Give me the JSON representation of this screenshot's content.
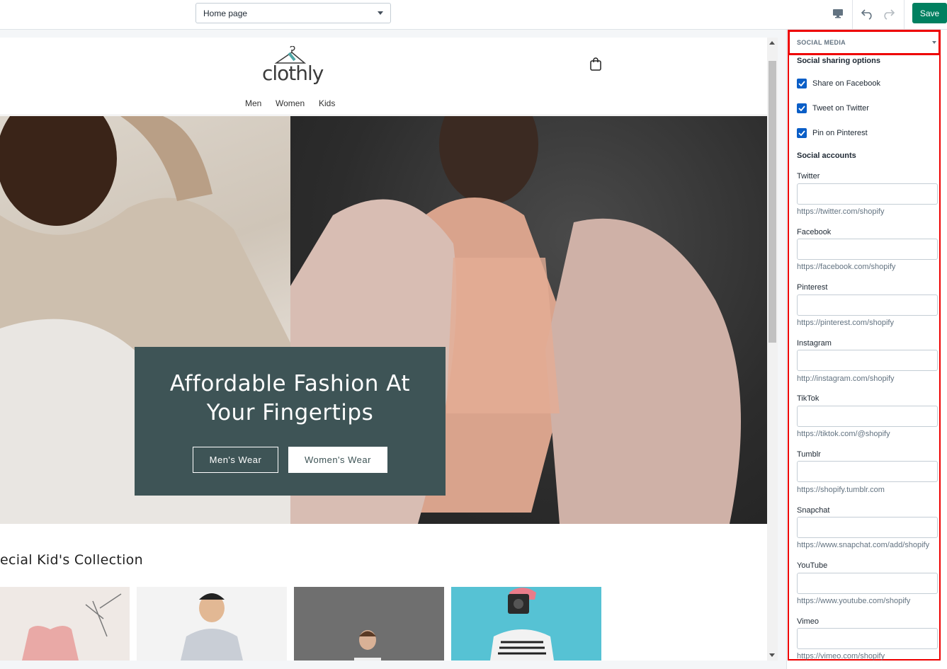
{
  "toolbar": {
    "page_select_value": "Home page",
    "desktop_icon": "desktop-icon",
    "undo_icon": "undo-icon",
    "redo_icon": "redo-icon",
    "save_label": "Save",
    "save_color": "#008060"
  },
  "store": {
    "logo_text": "clothly",
    "nav": [
      "Men",
      "Women",
      "Kids"
    ],
    "hero": {
      "title_line1": "Affordable Fashion At",
      "title_line2": "Your Fingertips",
      "btn_mens": "Men's Wear",
      "btn_womens": "Women's Wear",
      "box_color": "#3e5456"
    },
    "collection_title": "ecial Kid's Collection"
  },
  "panel": {
    "section_title": "SOCIAL MEDIA",
    "sharing_heading": "Social sharing options",
    "sharing_options": [
      {
        "label": "Share on Facebook",
        "checked": true
      },
      {
        "label": "Tweet on Twitter",
        "checked": true
      },
      {
        "label": "Pin on Pinterest",
        "checked": true
      }
    ],
    "accounts_heading": "Social accounts",
    "accounts": [
      {
        "label": "Twitter",
        "value": "",
        "help": "https://twitter.com/shopify"
      },
      {
        "label": "Facebook",
        "value": "",
        "help": "https://facebook.com/shopify"
      },
      {
        "label": "Pinterest",
        "value": "",
        "help": "https://pinterest.com/shopify"
      },
      {
        "label": "Instagram",
        "value": "",
        "help": "http://instagram.com/shopify"
      },
      {
        "label": "TikTok",
        "value": "",
        "help": "https://tiktok.com/@shopify"
      },
      {
        "label": "Tumblr",
        "value": "",
        "help": "https://shopify.tumblr.com"
      },
      {
        "label": "Snapchat",
        "value": "",
        "help": "https://www.snapchat.com/add/shopify"
      },
      {
        "label": "YouTube",
        "value": "",
        "help": "https://www.youtube.com/shopify"
      },
      {
        "label": "Vimeo",
        "value": "",
        "help": "https://vimeo.com/shopify"
      }
    ],
    "highlight_color": "#e00000"
  }
}
